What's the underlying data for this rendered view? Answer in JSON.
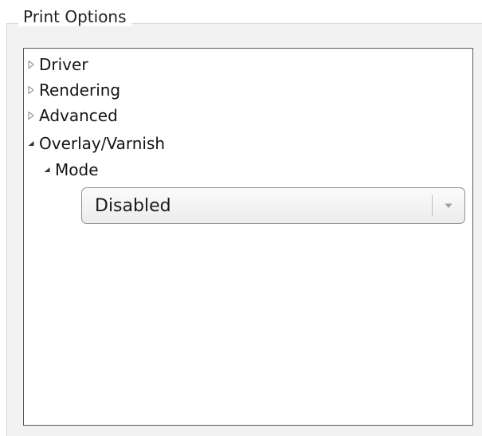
{
  "group": {
    "title": "Print Options"
  },
  "tree": {
    "items": [
      {
        "label": "Driver",
        "expanded": false,
        "icon": "triangle-right-icon"
      },
      {
        "label": "Rendering",
        "expanded": false,
        "icon": "triangle-right-icon"
      },
      {
        "label": "Advanced",
        "expanded": false,
        "icon": "triangle-right-icon"
      },
      {
        "label": "Overlay/Varnish",
        "expanded": true,
        "icon": "triangle-down-icon"
      },
      {
        "label": "Mode",
        "expanded": true,
        "icon": "triangle-down-icon"
      }
    ]
  },
  "mode_select": {
    "value": "Disabled",
    "icon": "chevron-down-icon"
  },
  "colors": {
    "arrow_collapsed": "#9a9a9a",
    "arrow_expanded": "#333333"
  }
}
